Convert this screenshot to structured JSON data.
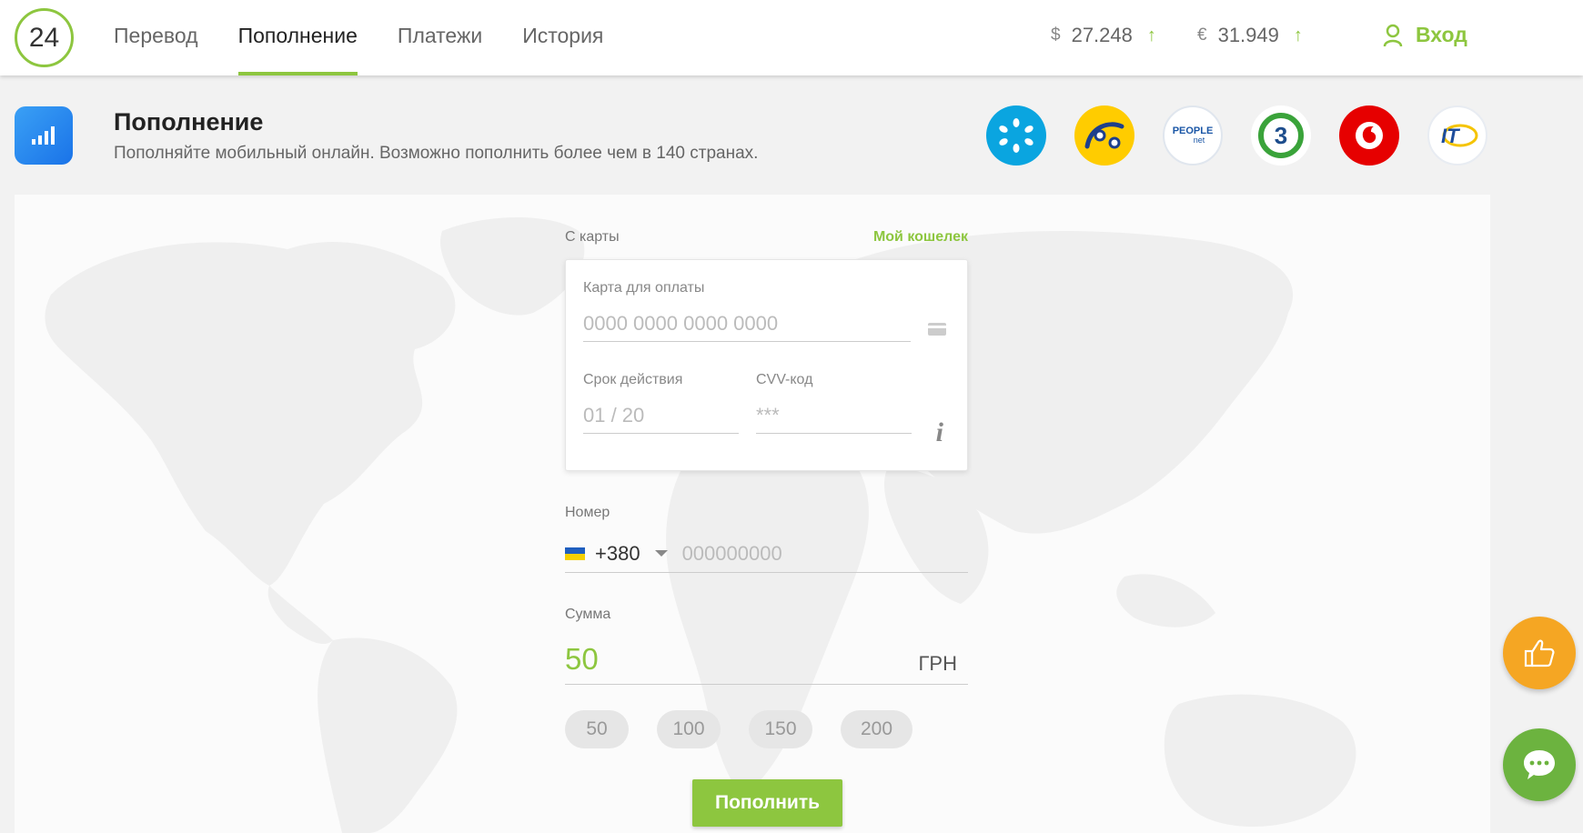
{
  "header": {
    "logo": "24",
    "nav": [
      {
        "label": "Перевод",
        "active": false
      },
      {
        "label": "Пополнение",
        "active": true
      },
      {
        "label": "Платежи",
        "active": false
      },
      {
        "label": "История",
        "active": false
      }
    ],
    "rates": [
      {
        "currency": "$",
        "value": "27.248",
        "arrow": "↑"
      },
      {
        "currency": "€",
        "value": "31.949",
        "arrow": "↑"
      }
    ],
    "login_label": "Вход"
  },
  "title": {
    "heading": "Пополнение",
    "subtitle": "Пополняйте мобильный онлайн. Возможно пополнить более чем в 140 странах."
  },
  "operators": [
    "kyivstar-logo",
    "lifecell-logo",
    "peoplenet-logo",
    "3mob-logo",
    "vodafone-logo",
    "intertelecom-logo"
  ],
  "operator_logo_text": {
    "peoplenet": "PEOPLE",
    "peoplenet_sub": "net",
    "mob3": "3",
    "intertelecom": "IT"
  },
  "form": {
    "from_card_label": "С карты",
    "wallet_link": "Мой кошелек",
    "card_number_label": "Карта для оплаты",
    "card_number_placeholder": "0000 0000 0000 0000",
    "expiry_label": "Срок действия",
    "expiry_placeholder": "01 / 20",
    "cvv_label": "CVV-код",
    "cvv_placeholder": "***",
    "info_icon": "i",
    "phone_label": "Номер",
    "phone_code": "+380",
    "phone_placeholder": "000000000",
    "sum_label": "Сумма",
    "sum_value": "50",
    "sum_currency": "ГРН",
    "quick_amounts": [
      "50",
      "100",
      "150",
      "200"
    ],
    "submit_label": "Пополнить"
  },
  "colors": {
    "accent": "#8dc63f",
    "like_button": "#f5a623",
    "chat_button": "#6cb33f"
  }
}
